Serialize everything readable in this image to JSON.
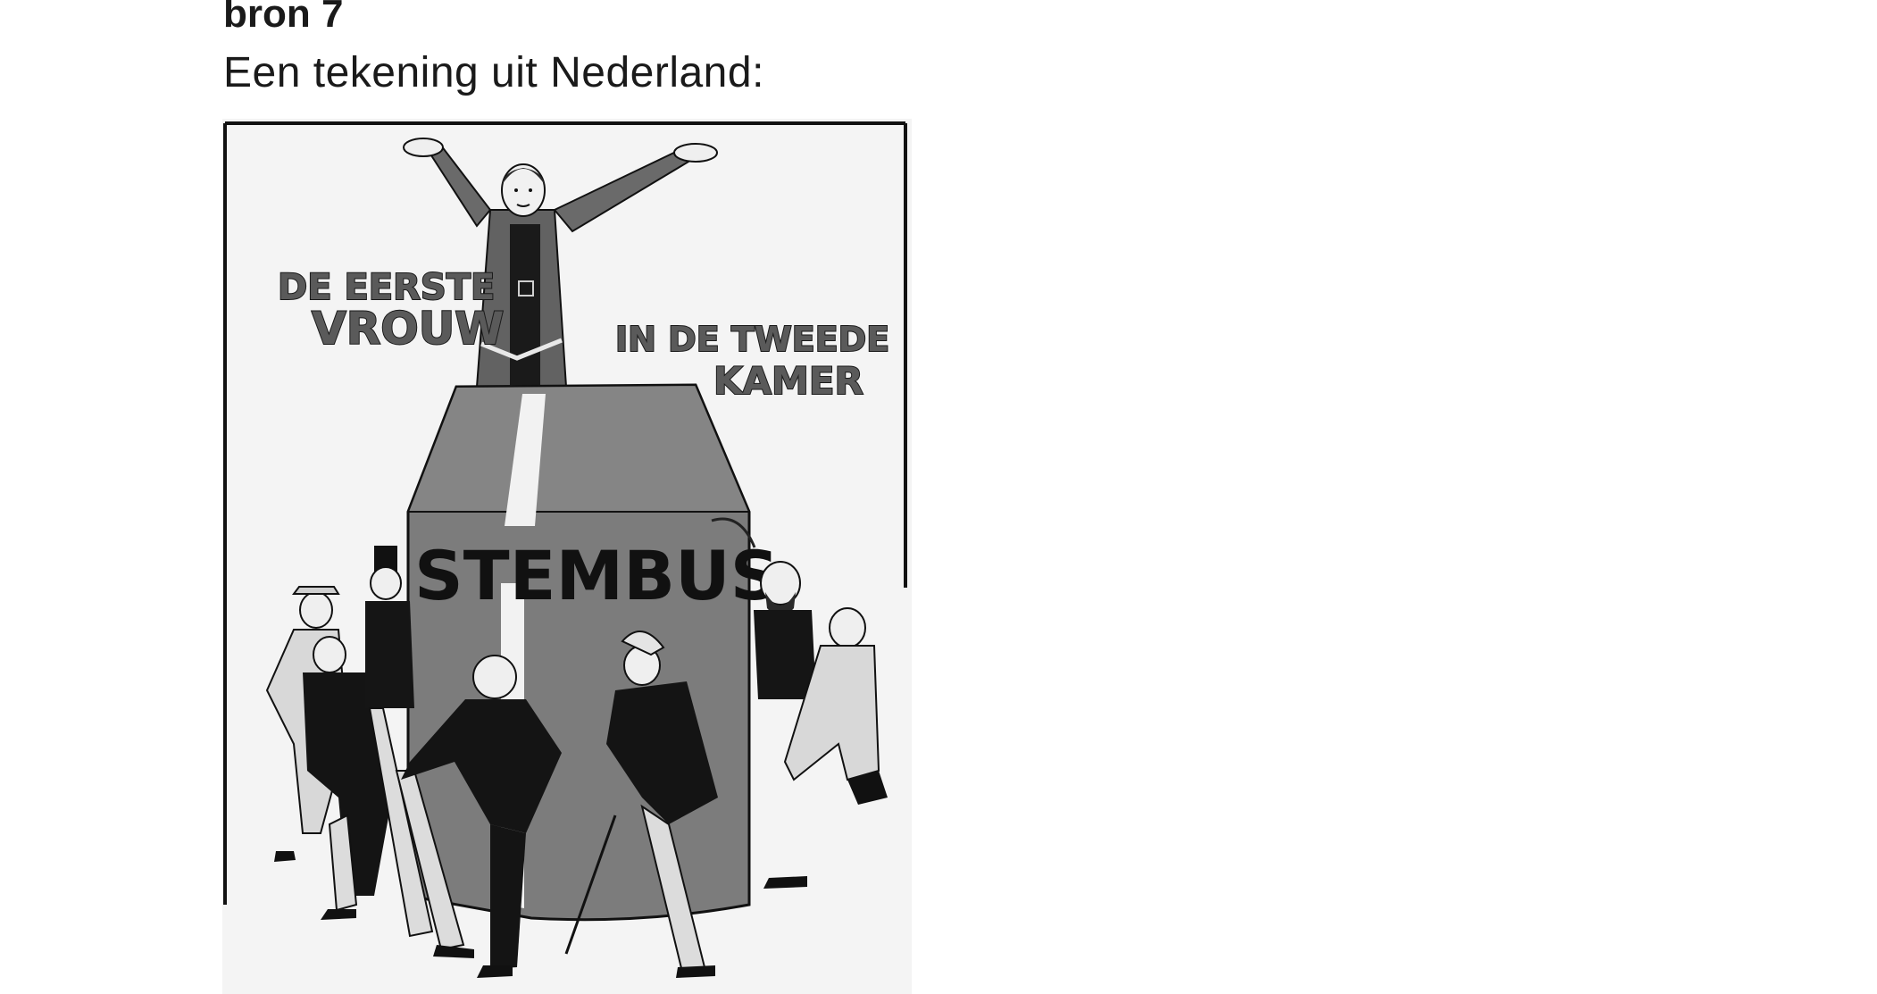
{
  "source": {
    "label": "bron 7",
    "description": "Een tekening uit Nederland:"
  },
  "cartoon": {
    "caption_line1": "DE EERSTE",
    "caption_line2": "VROUW",
    "caption_line3": "IN DE TWEEDE",
    "caption_line4": "KAMER",
    "ballot_box_label": "STEMBUS"
  }
}
